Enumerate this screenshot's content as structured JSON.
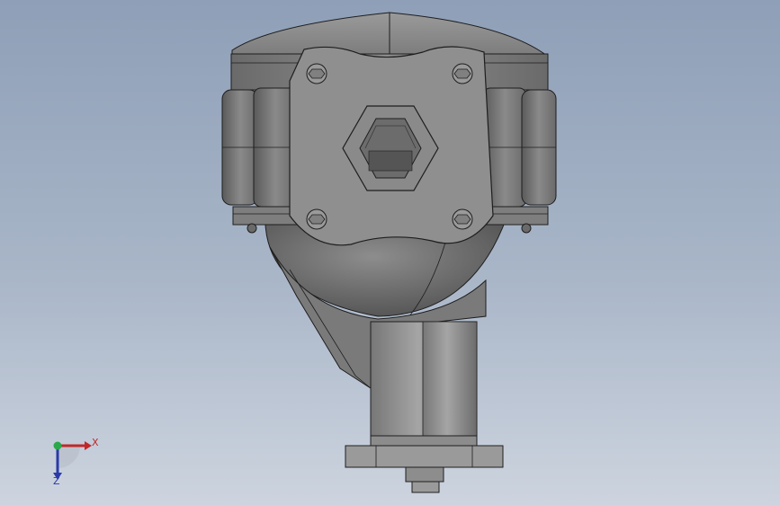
{
  "viewport": {
    "background_top": "#8e9fb7",
    "background_bottom": "#cdd4df",
    "model_fill": "#8a8a8a",
    "model_dark": "#5e5e5e",
    "model_light": "#a8a8a8",
    "edge_color": "#1e1e1e"
  },
  "triad": {
    "x_label": "X",
    "z_label": "Z",
    "x_color": "#c0282a",
    "y_color": "#2aa84a",
    "z_color": "#2a3aa8"
  }
}
